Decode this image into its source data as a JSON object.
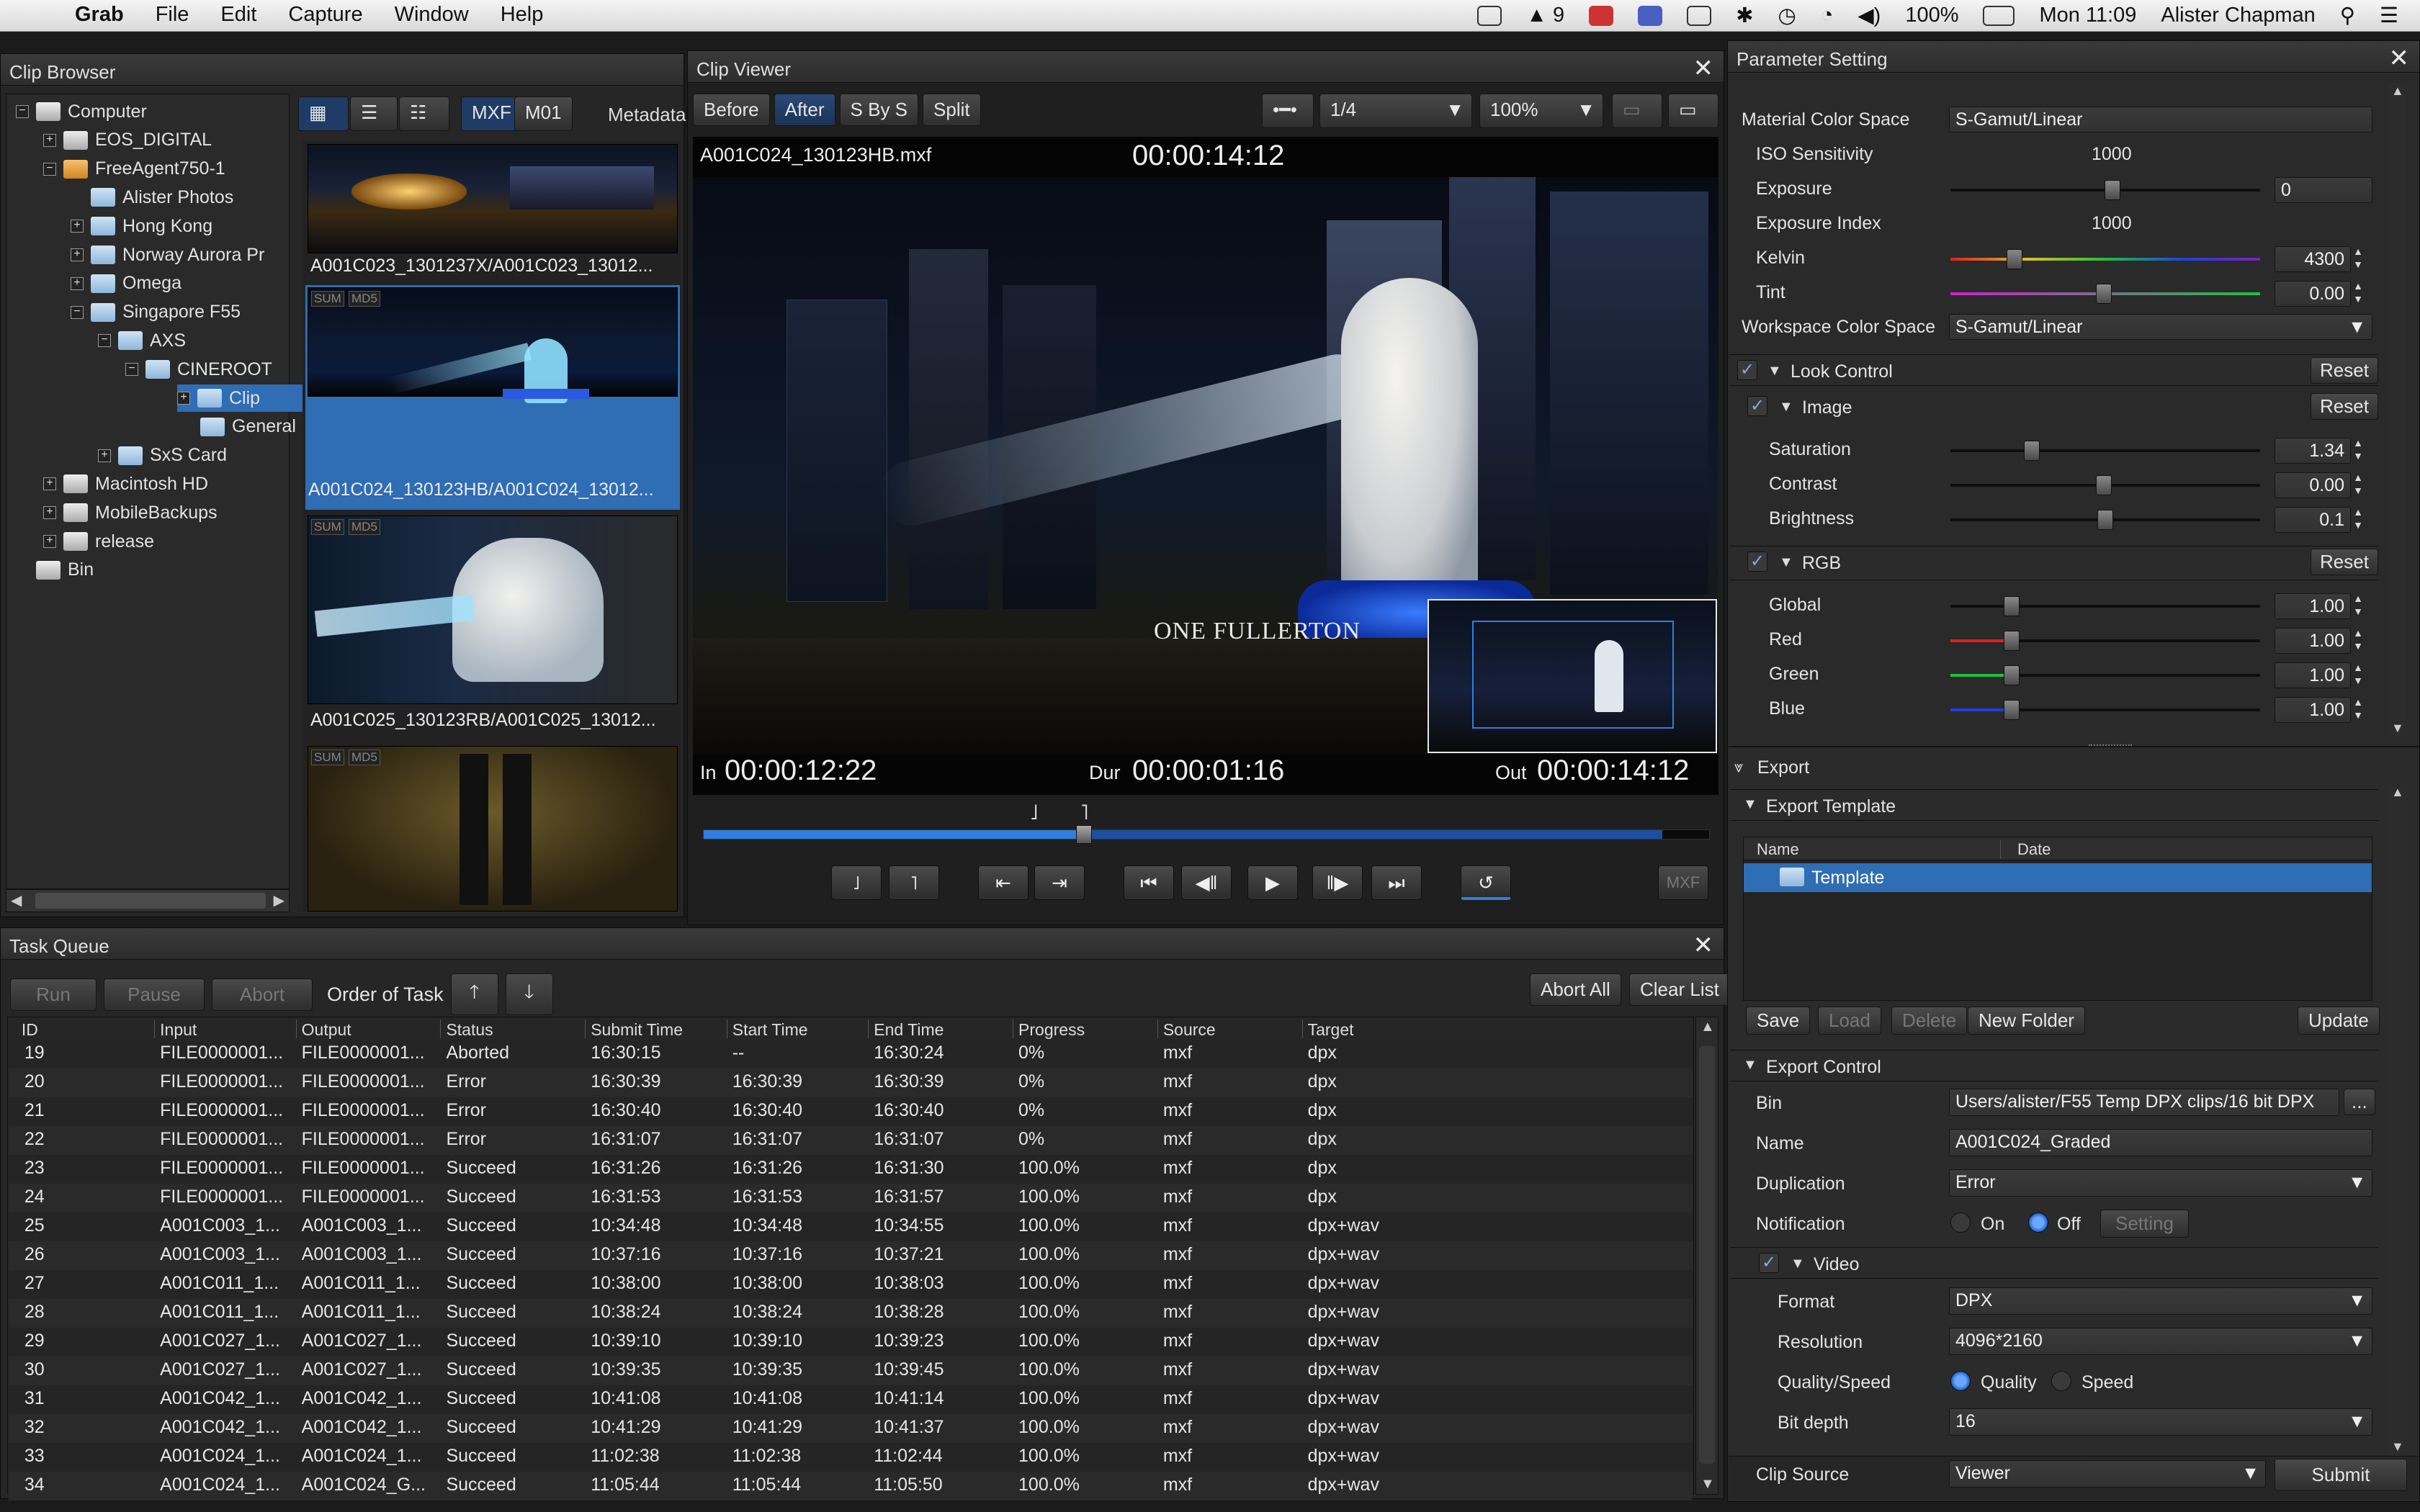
{
  "menubar": {
    "app": "Grab",
    "menus": [
      "File",
      "Edit",
      "Capture",
      "Window",
      "Help"
    ],
    "status_badge": "9",
    "battery": "100%",
    "clock": "Mon 11:09",
    "user": "Alister Chapman"
  },
  "clip_browser": {
    "title": "Clip Browser",
    "tree": [
      {
        "label": "Computer",
        "expander": "−"
      },
      {
        "label": "EOS_DIGITAL",
        "expander": "+"
      },
      {
        "label": "FreeAgent750-1",
        "expander": "−"
      },
      {
        "label": "Alister Photos",
        "expander": ""
      },
      {
        "label": "Hong Kong",
        "expander": "+"
      },
      {
        "label": "Norway Aurora Pr",
        "expander": "+"
      },
      {
        "label": "Omega",
        "expander": "+"
      },
      {
        "label": "Singapore F55",
        "expander": "−"
      },
      {
        "label": "AXS",
        "expander": "−"
      },
      {
        "label": "CINEROOT",
        "expander": "−"
      },
      {
        "label": "Clip",
        "expander": "+"
      },
      {
        "label": "General",
        "expander": ""
      },
      {
        "label": "SxS Card",
        "expander": "+"
      },
      {
        "label": "Macintosh HD",
        "expander": "+"
      },
      {
        "label": "MobileBackups",
        "expander": "+"
      },
      {
        "label": "release",
        "expander": "+"
      },
      {
        "label": "Bin",
        "expander": ""
      }
    ],
    "filter_tabs": [
      "MXF",
      "M01"
    ],
    "metadata_label": "Metadata",
    "badges": [
      "SUM",
      "MD5"
    ],
    "clips": [
      "A001C023_1301237X/A001C023_13012...",
      "A001C024_130123HB/A001C024_13012...",
      "A001C025_130123RB/A001C025_13012..."
    ]
  },
  "clip_viewer": {
    "title": "Clip Viewer",
    "tabs": [
      "Before",
      "After",
      "S By S",
      "Split"
    ],
    "resolution_select": "1/4",
    "zoom_select": "100%",
    "filename": "A001C024_130123HB.mxf",
    "timecode": "00:00:14:12",
    "in_label": "In",
    "in_tc": "00:00:12:22",
    "dur_label": "Dur",
    "dur_tc": "00:00:01:16",
    "out_label": "Out",
    "out_tc": "00:00:14:12",
    "mxf_button": "MXF",
    "overlay_text": "ONE FULLERTON"
  },
  "task_queue": {
    "title": "Task Queue",
    "buttons": {
      "run": "Run",
      "pause": "Pause",
      "abort": "Abort",
      "order": "Order of Task",
      "abort_all": "Abort All",
      "clear_list": "Clear List"
    },
    "columns": [
      "ID",
      "Input",
      "Output",
      "Status",
      "Submit Time",
      "Start Time",
      "End Time",
      "Progress",
      "Source",
      "Target"
    ],
    "rows": [
      [
        "19",
        "FILE0000001...",
        "FILE0000001...",
        "Aborted",
        "16:30:15",
        "--",
        "16:30:24",
        "0%",
        "mxf",
        "dpx"
      ],
      [
        "20",
        "FILE0000001...",
        "FILE0000001...",
        "Error",
        "16:30:39",
        "16:30:39",
        "16:30:39",
        "0%",
        "mxf",
        "dpx"
      ],
      [
        "21",
        "FILE0000001...",
        "FILE0000001...",
        "Error",
        "16:30:40",
        "16:30:40",
        "16:30:40",
        "0%",
        "mxf",
        "dpx"
      ],
      [
        "22",
        "FILE0000001...",
        "FILE0000001...",
        "Error",
        "16:31:07",
        "16:31:07",
        "16:31:07",
        "0%",
        "mxf",
        "dpx"
      ],
      [
        "23",
        "FILE0000001...",
        "FILE0000001...",
        "Succeed",
        "16:31:26",
        "16:31:26",
        "16:31:30",
        "100.0%",
        "mxf",
        "dpx"
      ],
      [
        "24",
        "FILE0000001...",
        "FILE0000001...",
        "Succeed",
        "16:31:53",
        "16:31:53",
        "16:31:57",
        "100.0%",
        "mxf",
        "dpx"
      ],
      [
        "25",
        "A001C003_1...",
        "A001C003_1...",
        "Succeed",
        "10:34:48",
        "10:34:48",
        "10:34:55",
        "100.0%",
        "mxf",
        "dpx+wav"
      ],
      [
        "26",
        "A001C003_1...",
        "A001C003_1...",
        "Succeed",
        "10:37:16",
        "10:37:16",
        "10:37:21",
        "100.0%",
        "mxf",
        "dpx+wav"
      ],
      [
        "27",
        "A001C011_1...",
        "A001C011_1...",
        "Succeed",
        "10:38:00",
        "10:38:00",
        "10:38:03",
        "100.0%",
        "mxf",
        "dpx+wav"
      ],
      [
        "28",
        "A001C011_1...",
        "A001C011_1...",
        "Succeed",
        "10:38:24",
        "10:38:24",
        "10:38:28",
        "100.0%",
        "mxf",
        "dpx+wav"
      ],
      [
        "29",
        "A001C027_1...",
        "A001C027_1...",
        "Succeed",
        "10:39:10",
        "10:39:10",
        "10:39:23",
        "100.0%",
        "mxf",
        "dpx+wav"
      ],
      [
        "30",
        "A001C027_1...",
        "A001C027_1...",
        "Succeed",
        "10:39:35",
        "10:39:35",
        "10:39:45",
        "100.0%",
        "mxf",
        "dpx+wav"
      ],
      [
        "31",
        "A001C042_1...",
        "A001C042_1...",
        "Succeed",
        "10:41:08",
        "10:41:08",
        "10:41:14",
        "100.0%",
        "mxf",
        "dpx+wav"
      ],
      [
        "32",
        "A001C042_1...",
        "A001C042_1...",
        "Succeed",
        "10:41:29",
        "10:41:29",
        "10:41:37",
        "100.0%",
        "mxf",
        "dpx+wav"
      ],
      [
        "33",
        "A001C024_1...",
        "A001C024_1...",
        "Succeed",
        "11:02:38",
        "11:02:38",
        "11:02:44",
        "100.0%",
        "mxf",
        "dpx+wav"
      ],
      [
        "34",
        "A001C024_1...",
        "A001C024_G...",
        "Succeed",
        "11:05:44",
        "11:05:44",
        "11:05:50",
        "100.0%",
        "mxf",
        "dpx+wav"
      ]
    ]
  },
  "params": {
    "title": "Parameter Setting",
    "material_color_space_label": "Material Color Space",
    "material_color_space": "S-Gamut/Linear",
    "iso_label": "ISO Sensitivity",
    "iso": "1000",
    "exposure_label": "Exposure",
    "exposure": "0",
    "exposure_index_label": "Exposure Index",
    "exposure_index": "1000",
    "kelvin_label": "Kelvin",
    "kelvin": "4300",
    "tint_label": "Tint",
    "tint": "0.00",
    "workspace_label": "Workspace Color Space",
    "workspace": "S-Gamut/Linear",
    "look_control": "Look Control",
    "image": "Image",
    "reset": "Reset",
    "saturation_label": "Saturation",
    "saturation": "1.34",
    "contrast_label": "Contrast",
    "contrast": "0.00",
    "brightness_label": "Brightness",
    "brightness": "0.1",
    "rgb": "RGB",
    "global_label": "Global",
    "global": "1.00",
    "red_label": "Red",
    "red": "1.00",
    "green_label": "Green",
    "green": "1.00",
    "blue_label": "Blue",
    "blue": "1.00"
  },
  "export": {
    "title": "Export",
    "template_title": "Export Template",
    "col_name": "Name",
    "col_date": "Date",
    "template_item": "Template",
    "save": "Save",
    "load": "Load",
    "delete": "Delete",
    "new_folder": "New Folder",
    "update": "Update",
    "control_title": "Export Control",
    "bin_label": "Bin",
    "bin": "Users/alister/F55 Temp DPX clips/16 bit DPX",
    "bin_button": "...",
    "name_label": "Name",
    "name": "A001C024_Graded",
    "duplication_label": "Duplication",
    "duplication": "Error",
    "notification_label": "Notification",
    "on": "On",
    "off": "Off",
    "setting": "Setting",
    "video": "Video",
    "format_label": "Format",
    "format": "DPX",
    "resolution_label": "Resolution",
    "resolution": "4096*2160",
    "quality_speed_label": "Quality/Speed",
    "quality": "Quality",
    "speed": "Speed",
    "bitdepth_label": "Bit depth",
    "bitdepth": "16",
    "clip_source_label": "Clip Source",
    "clip_source": "Viewer",
    "submit": "Submit"
  },
  "colors": {
    "accent": "#2f7fe0",
    "selection": "#2f6db5",
    "panel": "#262626"
  }
}
